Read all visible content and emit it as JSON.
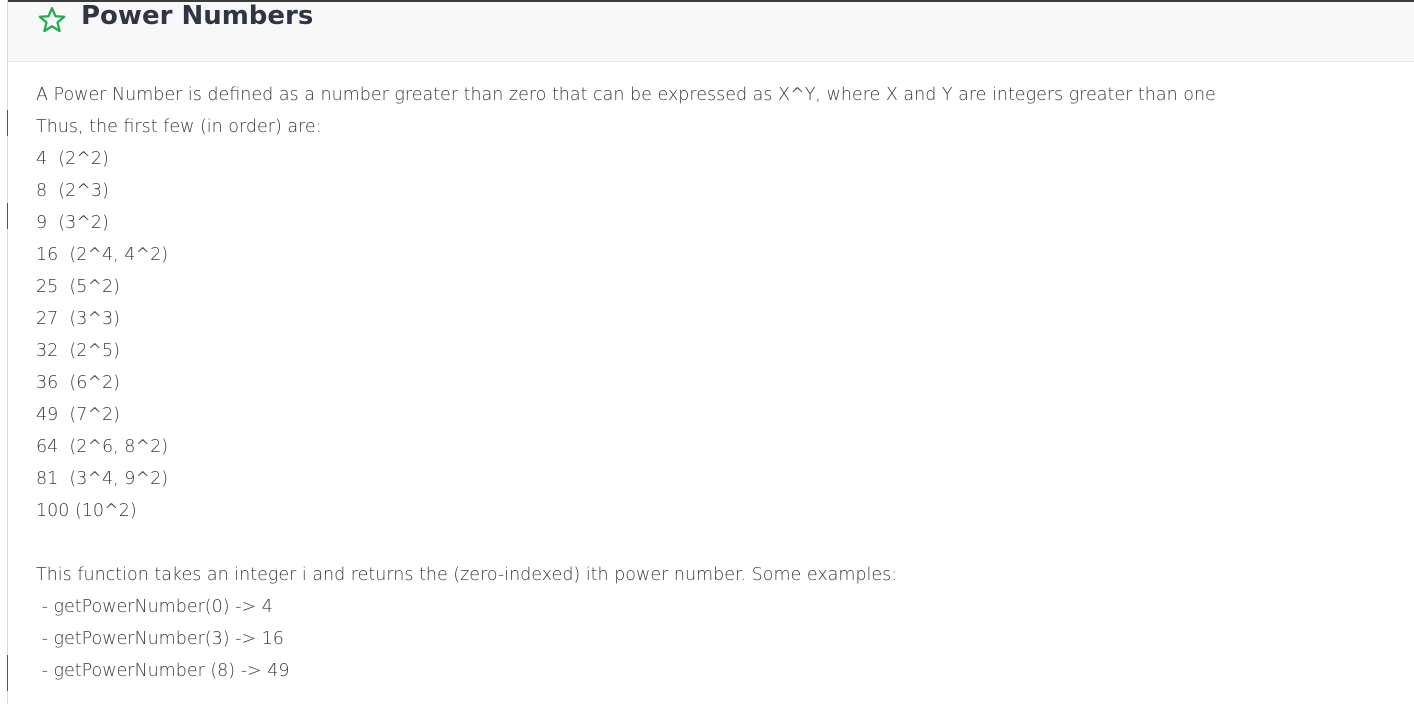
{
  "header": {
    "title": "Power Numbers",
    "icon": "star-outline-icon",
    "icon_color": "#1fae4a"
  },
  "content": {
    "intro_line_1": "A Power Number is defined as a number greater than zero that can be expressed as X^Y, where X and Y are integers greater than one",
    "intro_line_2": "Thus, the first few (in order) are:",
    "list": [
      "4  (2^2)",
      "8  (2^3)",
      "9  (3^2)",
      "16  (2^4, 4^2)",
      "25  (5^2)",
      "27  (3^3)",
      "32  (2^5)",
      "36  (6^2)",
      "49  (7^2)",
      "64  (2^6, 8^2)",
      "81  (3^4, 9^2)",
      "100 (10^2)"
    ],
    "description": "This function takes an integer i and returns the (zero-indexed) ith power number. Some examples:",
    "examples": [
      " - getPowerNumber(0) -> 4",
      " - getPowerNumber(3) -> 16",
      " - getPowerNumber (8) -> 49"
    ]
  }
}
